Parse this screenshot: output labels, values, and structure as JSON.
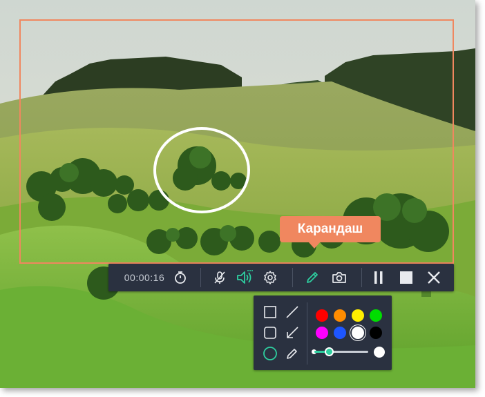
{
  "toolbar": {
    "timer": "00:00:16",
    "icons": [
      "timer-icon",
      "microphone-muted-icon",
      "speaker-icon",
      "gear-icon",
      "pencil-icon",
      "camera-icon",
      "pause-icon",
      "stop-icon",
      "close-icon"
    ],
    "active_color": "#2ecfa0"
  },
  "tooltip": {
    "label": "Карандаш"
  },
  "draw_panel": {
    "tools": [
      "rectangle-icon",
      "line-icon",
      "rounded-rectangle-icon",
      "arrow-icon",
      "ellipse-icon",
      "pencil-icon"
    ],
    "selected_tool": "ellipse-icon",
    "colors": [
      "#ff0000",
      "#ff8c00",
      "#ffee00",
      "#00dd00",
      "#ff00ff",
      "#1e56ff",
      "#ffffff",
      "#000000"
    ],
    "selected_color": "#ffffff",
    "brush_size_fraction": 0.27
  },
  "accent": {
    "frame": "#f0875f",
    "panel_bg": "#2a3140"
  }
}
